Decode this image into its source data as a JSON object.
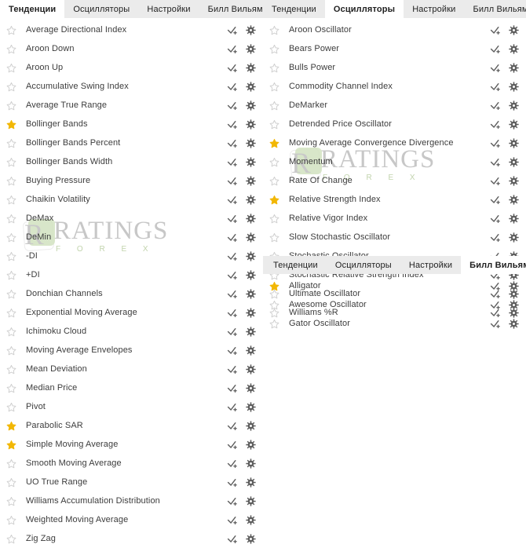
{
  "colors": {
    "star_active": "#f2b705",
    "star_inactive": "#cfcfcf",
    "icon": "#5e5e5e",
    "tab_bar_bg": "#ebebeb",
    "tab_active_bg": "#ffffff",
    "text": "#3c3c3c",
    "watermark_green": "#8fb06a",
    "watermark_gray": "#9b9b9b"
  },
  "watermark": {
    "letter": "R",
    "main": "RATINGS",
    "sub": "F O R E X"
  },
  "icons": {
    "star": "star-icon",
    "apply": "check-plus-icon",
    "settings": "gear-icon"
  },
  "panels": [
    {
      "id": "panel-trends",
      "name": "trends",
      "tabs": [
        {
          "label": "Тенденции",
          "active": true
        },
        {
          "label": "Осцилляторы",
          "active": false
        },
        {
          "label": "Настройки",
          "active": false
        },
        {
          "label": "Билл Вильямс",
          "active": false
        }
      ],
      "items": [
        {
          "label": "Average Directional Index",
          "favorite": false
        },
        {
          "label": "Aroon Down",
          "favorite": false
        },
        {
          "label": "Aroon Up",
          "favorite": false
        },
        {
          "label": "Accumulative Swing Index",
          "favorite": false
        },
        {
          "label": "Average True Range",
          "favorite": false
        },
        {
          "label": "Bollinger Bands",
          "favorite": true
        },
        {
          "label": "Bollinger Bands Percent",
          "favorite": false
        },
        {
          "label": "Bollinger Bands Width",
          "favorite": false
        },
        {
          "label": "Buying Pressure",
          "favorite": false
        },
        {
          "label": "Chaikin Volatility",
          "favorite": false
        },
        {
          "label": "DeMax",
          "favorite": false
        },
        {
          "label": "DeMin",
          "favorite": false
        },
        {
          "label": "-DI",
          "favorite": false
        },
        {
          "label": "+DI",
          "favorite": false
        },
        {
          "label": "Donchian Channels",
          "favorite": false
        },
        {
          "label": "Exponential Moving Average",
          "favorite": false
        },
        {
          "label": "Ichimoku Cloud",
          "favorite": false
        },
        {
          "label": "Moving Average Envelopes",
          "favorite": false
        },
        {
          "label": "Mean Deviation",
          "favorite": false
        },
        {
          "label": "Median Price",
          "favorite": false
        },
        {
          "label": "Pivot",
          "favorite": false
        },
        {
          "label": "Parabolic SAR",
          "favorite": true
        },
        {
          "label": "Simple Moving Average",
          "favorite": true
        },
        {
          "label": "Smooth Moving Average",
          "favorite": false
        },
        {
          "label": "UO True Range",
          "favorite": false
        },
        {
          "label": "Williams Accumulation Distribution",
          "favorite": false
        },
        {
          "label": "Weighted Moving Average",
          "favorite": false
        },
        {
          "label": "Zig Zag",
          "favorite": false
        }
      ]
    },
    {
      "id": "panel-osc",
      "name": "oscillators",
      "tabs": [
        {
          "label": "Тенденции",
          "active": false
        },
        {
          "label": "Осцилляторы",
          "active": true
        },
        {
          "label": "Настройки",
          "active": false
        },
        {
          "label": "Билл Вильямс",
          "active": false
        }
      ],
      "items": [
        {
          "label": "Aroon Oscillator",
          "favorite": false
        },
        {
          "label": "Bears Power",
          "favorite": false
        },
        {
          "label": "Bulls Power",
          "favorite": false
        },
        {
          "label": "Commodity Channel Index",
          "favorite": false
        },
        {
          "label": "DeMarker",
          "favorite": false
        },
        {
          "label": "Detrended Price Oscillator",
          "favorite": false
        },
        {
          "label": "Moving Average Convergence Divergence",
          "favorite": true
        },
        {
          "label": "Momentum",
          "favorite": false
        },
        {
          "label": "Rate Of Change",
          "favorite": false
        },
        {
          "label": "Relative Strength Index",
          "favorite": true
        },
        {
          "label": "Relative Vigor Index",
          "favorite": false
        },
        {
          "label": "Slow Stochastic Oscillator",
          "favorite": false
        },
        {
          "label": "Stochastic Oscillator",
          "favorite": false
        },
        {
          "label": "Stochastic Relative Strength Index",
          "favorite": false
        },
        {
          "label": "Ultimate Oscillator",
          "favorite": false
        },
        {
          "label": "Williams %R",
          "favorite": false
        }
      ]
    },
    {
      "id": "panel-bw",
      "name": "bill-williams",
      "tabs": [
        {
          "label": "Тенденции",
          "active": false
        },
        {
          "label": "Осцилляторы",
          "active": false
        },
        {
          "label": "Настройки",
          "active": false
        },
        {
          "label": "Билл Вильямс",
          "active": true
        }
      ],
      "items": [
        {
          "label": "Alligator",
          "favorite": true
        },
        {
          "label": "Awesome Oscillator",
          "favorite": false
        },
        {
          "label": "Gator Oscillator",
          "favorite": false
        }
      ]
    }
  ]
}
